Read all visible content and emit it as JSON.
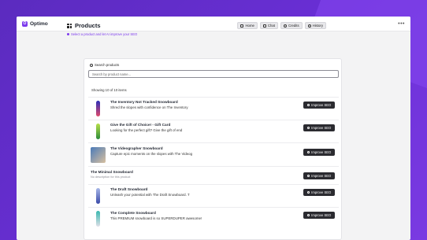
{
  "app": {
    "name": "Optimo",
    "logo_glyph": "O"
  },
  "header": {
    "title": "Products",
    "subtitle": "Select a product and let AI improve your SEO",
    "nav": [
      {
        "label": "Home",
        "icon": "home-icon"
      },
      {
        "label": "Chat",
        "icon": "chat-icon"
      },
      {
        "label": "Credits",
        "icon": "credits-icon"
      },
      {
        "label": "History",
        "icon": "history-icon"
      }
    ]
  },
  "search": {
    "label": "Search products",
    "placeholder": "Search by product name..."
  },
  "list": {
    "showing": "Showing 10 of 10 items",
    "button_label": "Improve SEO",
    "products": [
      {
        "title": "The Inventory Not Tracked Snowboard",
        "description": "Shred the slopes with confidence on The Inventory",
        "has_image": true,
        "colors": [
          "#2b2fb8",
          "#e04a6b"
        ]
      },
      {
        "title": "Give the Gift of Choice! - Gift Card",
        "description": "Looking for the perfect gift? Give the gift of end",
        "has_image": true,
        "colors": [
          "#b8e04a",
          "#2a8a3a"
        ]
      },
      {
        "title": "The Videographer Snowboard",
        "description": "Capture epic moments on the slopes with The Videog",
        "has_image": true,
        "colors": [
          "#4a7ab8",
          "#d8c0a0"
        ]
      },
      {
        "title": "The Minimal Snowboard",
        "description": "No description for this product",
        "has_image": false,
        "colors": []
      },
      {
        "title": "The Draft Snowboard",
        "description": "Unleash your potential with The Draft Snowboard. T",
        "has_image": true,
        "colors": [
          "#a8b8e8",
          "#3a4aa8"
        ]
      },
      {
        "title": "The Complete Snowboard",
        "description": "This PREMIUM snowboard is so SUPERDUPER awesome!",
        "has_image": true,
        "colors": [
          "#3ab8b0",
          "#e0e0e8"
        ]
      }
    ]
  },
  "colors": {
    "accent": "#7c3aed",
    "button_dark": "#2b2b30",
    "background": "#6a2fd6"
  }
}
